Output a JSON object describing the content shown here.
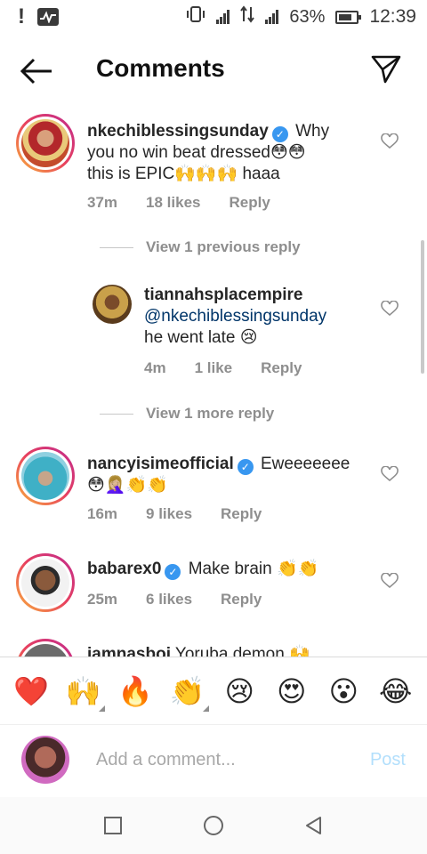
{
  "status_bar": {
    "battery": "63%",
    "time": "12:39",
    "icons": [
      "alert-icon",
      "activity-icon",
      "vibrate-icon",
      "signal-h-icon",
      "data-arrows-icon",
      "signal-h-plus-icon",
      "battery-icon"
    ]
  },
  "header": {
    "title": "Comments",
    "back_icon": "arrow-left-icon",
    "send_icon": "send-icon"
  },
  "comments": [
    {
      "username": "nkechiblessingsunday",
      "verified": true,
      "text_line1": " Why",
      "text_line2": "you no win beat dressed😳😳",
      "text_line3": "this is EPIC🙌🙌🙌 haaa",
      "time": "37m",
      "likes": "18 likes",
      "reply": "Reply"
    },
    {
      "username": "tiannahsplacempire",
      "mention": "@nkechiblessingsunday",
      "text": "he went late 😢",
      "time": "4m",
      "likes": "1 like",
      "reply": "Reply"
    },
    {
      "username": "nancyisimeofficial",
      "verified": true,
      "text_line1": " Eweeeeeee",
      "text_line2": "😳🤦🏼‍♀️👏👏",
      "time": "16m",
      "likes": "9 likes",
      "reply": "Reply"
    },
    {
      "username": "babarex0",
      "verified": true,
      "text": " Make brain 👏👏",
      "time": "25m",
      "likes": "6 likes",
      "reply": "Reply"
    },
    {
      "username": "iamnasboi",
      "text": " Yoruba demon 🙌"
    }
  ],
  "view_previous": "View 1 previous reply",
  "view_more": "View 1 more reply",
  "verified_mark": "✓",
  "emoji_bar": [
    "❤️",
    "🙌",
    "🔥",
    "👏",
    "😢",
    "😍",
    "😮",
    "😂"
  ],
  "add_comment": {
    "placeholder": "Add a comment...",
    "post_label": "Post"
  },
  "colors": {
    "verified": "#3897f0",
    "mention": "#003569",
    "meta": "#8e8e8e",
    "post_disabled": "#b2dffc"
  }
}
